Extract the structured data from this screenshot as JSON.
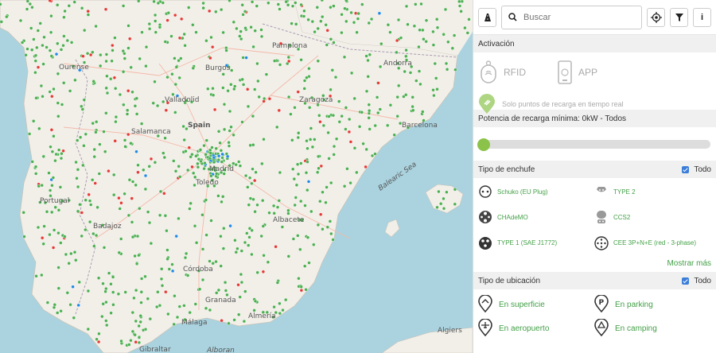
{
  "map": {
    "labels": {
      "spain": "Spain",
      "ourense": "Ourense",
      "burgos": "Burgos",
      "valladolid": "Valladolid",
      "salamanca": "Salamanca",
      "zaragoza": "Zaragoza",
      "pamplona": "Pamplona",
      "andorra": "Andorra",
      "barcelona": "Barcelona",
      "madrid": "Madrid",
      "toledo": "Toledo",
      "badajoz": "Badajoz",
      "albacete": "Albacete",
      "cordoba": "Córdoba",
      "granada": "Granada",
      "almeria": "Almería",
      "malaga": "Málaga",
      "gibraltar": "Gibraltar",
      "algiers": "Algiers",
      "balearic_sea": "Balearic Sea",
      "alboran": "Alboran",
      "portugal": "Portugal"
    },
    "colors": {
      "sea": "#aad3df",
      "land": "#f2efe9",
      "available": "#4caf50",
      "busy": "#e53935",
      "other": "#1e88e5"
    }
  },
  "toolbar": {
    "road_icon": "road-icon",
    "search_placeholder": "Buscar",
    "locate_icon": "locate-icon",
    "filter_icon": "filter-icon",
    "info_icon": "info-icon"
  },
  "activation": {
    "title": "Activación",
    "rfid": "RFID",
    "app": "APP",
    "realtime": "Solo puntos de recarga en tiempo real"
  },
  "power": {
    "title": "Potencia de recarga mínima: 0kW - Todos",
    "min_value": 0
  },
  "plugs": {
    "title": "Tipo de enchufe",
    "all": "Todo",
    "items": [
      {
        "label": "Schuko (EU Plug)",
        "icon": "schuko-icon"
      },
      {
        "label": "TYPE 2",
        "icon": "type2-icon"
      },
      {
        "label": "CHAdeMO",
        "icon": "chademo-icon"
      },
      {
        "label": "CCS2",
        "icon": "ccs2-icon"
      },
      {
        "label": "TYPE 1 (SAE J1772)",
        "icon": "type1-icon"
      },
      {
        "label": "CEE 3P+N+E (red - 3-phase)",
        "icon": "cee-icon"
      }
    ],
    "more": "Mostrar más"
  },
  "locations": {
    "title": "Tipo de ubicación",
    "all": "Todo",
    "items": [
      {
        "label": "En superficie",
        "icon": "surface-icon"
      },
      {
        "label": "En parking",
        "icon": "parking-icon"
      },
      {
        "label": "En aeropuerto",
        "icon": "airport-icon"
      },
      {
        "label": "En camping",
        "icon": "camping-icon"
      }
    ]
  }
}
